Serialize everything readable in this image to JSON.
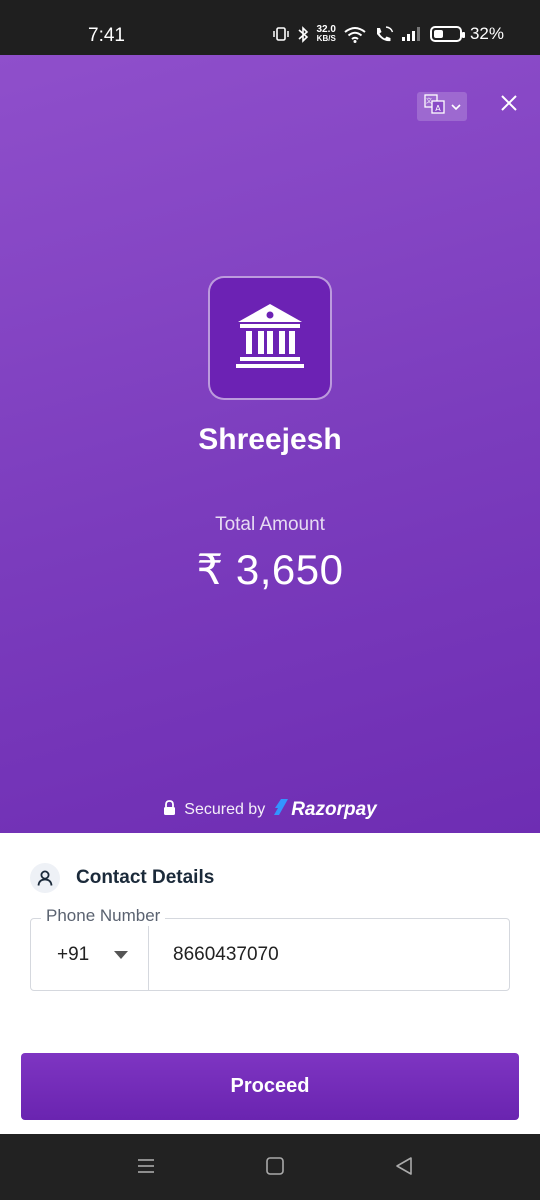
{
  "status_bar": {
    "time": "7:41",
    "network_speed_value": "32.0",
    "network_speed_unit": "KB/S",
    "battery_percent": "32%",
    "battery_level": 0.32
  },
  "header": {
    "merchant_name": "Shreejesh",
    "amount_label": "Total Amount",
    "amount_value": "₹ 3,650",
    "secured_by_text": "Secured by",
    "brand_name": "Razorpay",
    "icons": {
      "language": "translate-icon",
      "close": "close-icon",
      "merchant": "bank-icon",
      "lock": "lock-icon"
    }
  },
  "contact": {
    "title": "Contact Details",
    "phone_label": "Phone Number",
    "country_code": "+91",
    "phone_value": "8660437070"
  },
  "actions": {
    "proceed_label": "Proceed"
  },
  "colors": {
    "brand_purple": "#7b3cbd",
    "button_purple": "#6a24b0",
    "status_bar_bg": "#1f1f1f"
  }
}
